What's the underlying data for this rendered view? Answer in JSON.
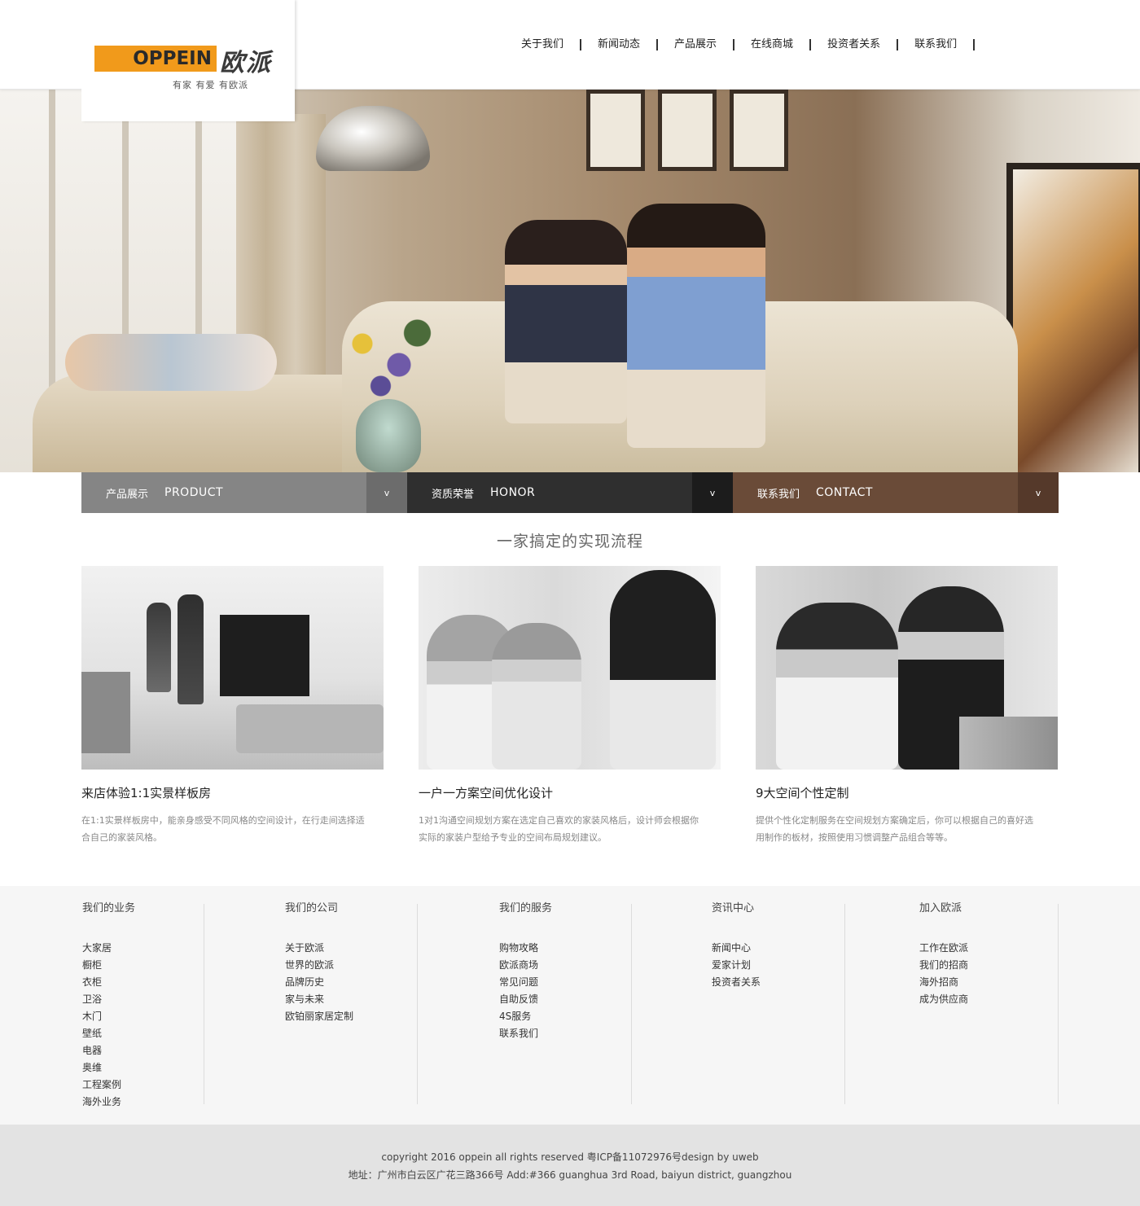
{
  "brand": {
    "logo_word": "OPPEIN",
    "logo_cn": "欧派",
    "slogan": "有家 有爱 有欧派",
    "accent": "#f19a1b"
  },
  "nav": {
    "items": [
      "关于我们",
      "新闻动态",
      "产品展示",
      "在线商城",
      "投资者关系",
      "联系我们"
    ]
  },
  "tabs": [
    {
      "cn": "产品展示",
      "en": "PRODUCT",
      "chevron": "v",
      "color": "#858585"
    },
    {
      "cn": "资质荣誉",
      "en": "HONOR",
      "chevron": "v",
      "color": "#2f2f2f"
    },
    {
      "cn": "联系我们",
      "en": "CONTACT",
      "chevron": "v",
      "color": "#6a4b38"
    }
  ],
  "process": {
    "title": "一家搞定的实现流程",
    "cards": [
      {
        "title": "来店体验1:1实景样板房",
        "desc": "在1:1实景样板房中，能亲身感受不同风格的空间设计，在行走间选择适合自己的家装风格。"
      },
      {
        "title": "一户一方案空间优化设计",
        "desc": "1对1沟通空间规划方案在选定自己喜欢的家装风格后，设计师会根据你实际的家装户型给予专业的空间布局规划建议。"
      },
      {
        "title": "9大空间个性定制",
        "desc": "提供个性化定制服务在空间规划方案确定后，你可以根据自己的喜好选用制作的板材，按照使用习惯调整产品组合等等。"
      }
    ]
  },
  "footer": {
    "columns": [
      {
        "title": "我们的业务",
        "links": [
          "大家居",
          "橱柜",
          "衣柜",
          "卫浴",
          "木门",
          "壁纸",
          "电器",
          "奥维",
          "工程案例",
          "海外业务"
        ]
      },
      {
        "title": "我们的公司",
        "links": [
          "关于欧派",
          "世界的欧派",
          "品牌历史",
          "家与未来",
          "欧铂丽家居定制"
        ]
      },
      {
        "title": "我们的服务",
        "links": [
          "购物攻略",
          "欧派商场",
          "常见问题",
          "自助反馈",
          "4S服务",
          "联系我们"
        ]
      },
      {
        "title": "资讯中心",
        "links": [
          "新闻中心",
          "爱家计划",
          "投资者关系"
        ]
      },
      {
        "title": "加入欧派",
        "links": [
          "工作在欧派",
          "我们的招商",
          "海外招商",
          "成为供应商"
        ]
      }
    ],
    "copyright": "copyright 2016 oppein all rights reserved 粤ICP备11072976号design by uweb",
    "address": "地址：广州市白云区广花三路366号 Add:#366 guanghua 3rd Road, baiyun district, guangzhou"
  }
}
